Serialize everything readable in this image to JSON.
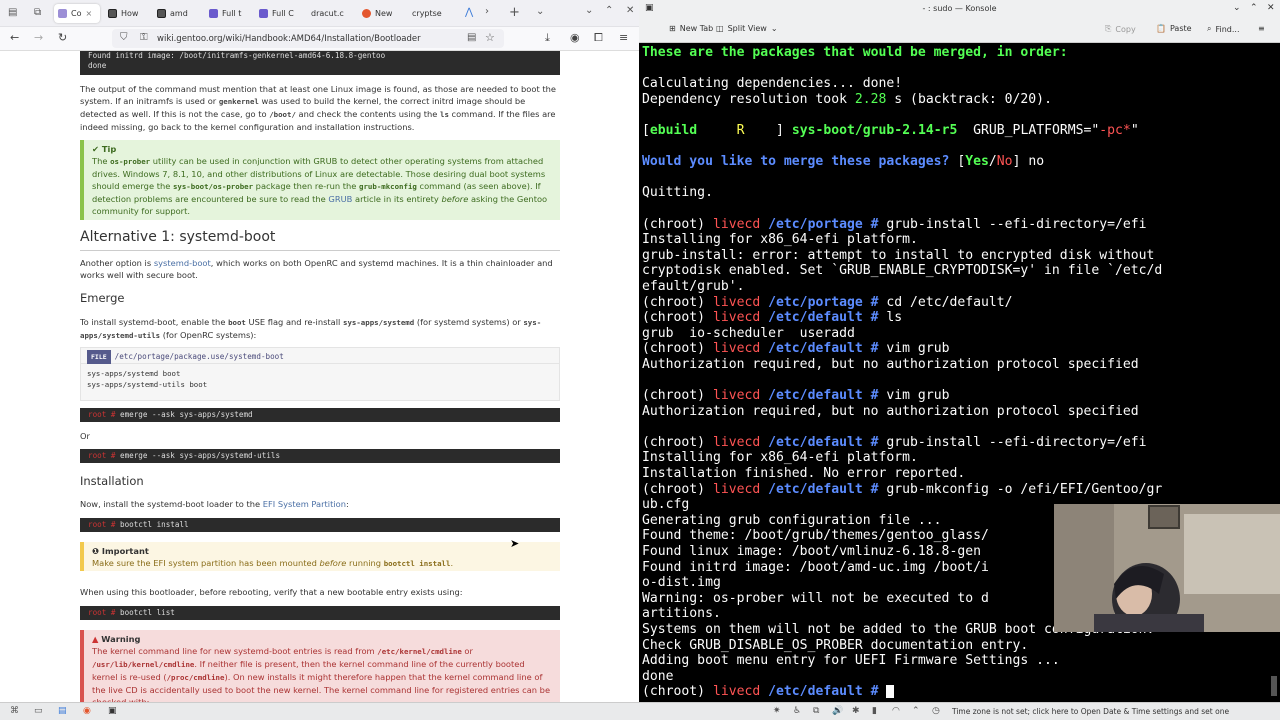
{
  "browser": {
    "tabs": [
      {
        "label": "Co",
        "active": true
      },
      {
        "label": "How"
      },
      {
        "label": "amd"
      },
      {
        "label": "Full t"
      },
      {
        "label": "Full C"
      },
      {
        "label": "dracut.c"
      },
      {
        "label": "New"
      },
      {
        "label": "cryptse"
      }
    ],
    "url": "wiki.gentoo.org/wiki/Handbook:AMD64/Installation/Bootloader",
    "content": {
      "code_top_line1": "Found initrd image: /boot/initramfs-genkernel-amd64-6.18.8-gentoo",
      "code_top_line2": "done",
      "para1": {
        "t1": "The output of the command must mention that at least one Linux image is found, as those are needed to boot the system. If an initramfs is used or ",
        "c1": "genkernel",
        "t2": " was used to build the kernel, the correct initrd image should be detected as well. If this is not the case, go to ",
        "c2": "/boot/",
        "t3": " and check the contents using the ",
        "c3": "ls",
        "t4": " command. If the files are indeed missing, go back to the kernel configuration and installation instructions."
      },
      "tip": {
        "title": "Tip",
        "t1": "The ",
        "c1": "os-prober",
        "t2": " utility can be used in conjunction with GRUB to detect other operating systems from attached drives. Windows 7, 8.1, 10, and other distributions of Linux are detectable. Those desiring dual boot systems should emerge the ",
        "c2": "sys-boot/os-prober",
        "t3": " package then re-run the ",
        "c3": "grub-mkconfig",
        "t4": " command (as seen above). If detection problems are encountered be sure to read the ",
        "link": "GRUB",
        "t5": " article in its entirety ",
        "em": "before",
        "t6": " asking the Gentoo community for support."
      },
      "alt_heading": "Alternative 1: systemd-boot",
      "alt_para": {
        "t1": "Another option is ",
        "link": "systemd-boot",
        "t2": ", which works on both OpenRC and systemd machines. It is a thin chainloader and works well with secure boot."
      },
      "emerge_heading": "Emerge",
      "emerge_para": {
        "t1": "To install systemd-boot, enable the ",
        "c1": "boot",
        "t2": " USE flag and re-install ",
        "c2": "sys-apps/systemd",
        "t3": " (for systemd systems) or ",
        "c3": "sys-apps/systemd-utils",
        "t4": " (for OpenRC systems):"
      },
      "file_badge": "FILE",
      "file_path": "/etc/portage/package.use/systemd-boot",
      "file_line1": "sys-apps/systemd boot",
      "file_line2": "sys-apps/systemd-utils boot",
      "root_prompt": "root #",
      "cmd1": "emerge --ask sys-apps/systemd",
      "or_text": "Or",
      "cmd2": "emerge --ask sys-apps/systemd-utils",
      "install_heading": "Installation",
      "install_para": {
        "t1": "Now, install the systemd-boot loader to the ",
        "link": "EFI System Partition",
        "t2": ":"
      },
      "cmd3": "bootctl install",
      "important": {
        "title": "Important",
        "t1": "Make sure the EFI system partition has been mounted ",
        "em": "before",
        "t2": " running ",
        "c1": "bootctl install",
        "t3": "."
      },
      "verify_para": "When using this bootloader, before rebooting, verify that a new bootable entry exists using:",
      "cmd4": "bootctl list",
      "warning": {
        "title": "Warning",
        "t1": "The kernel command line for new systemd-boot entries is read from ",
        "c1": "/etc/kernel/cmdline",
        "t2": " or ",
        "c2": "/usr/lib/kernel/cmdline",
        "t3": ". If neither file is present, then the kernel command line of the currently booted kernel is re-used (",
        "c3": "/proc/cmdline",
        "t4": "). On new installs it might therefore happen that the kernel command line of the live CD is accidentally used to boot the new kernel. The kernel command line for registered entries can be checked with:"
      }
    }
  },
  "konsole": {
    "title": "- : sudo — Konsole",
    "toolbar": {
      "new_tab": "New Tab",
      "split_view": "Split View",
      "copy": "Copy",
      "paste": "Paste",
      "find": "Find..."
    },
    "lines": {
      "l1": "These are the packages that would be merged, in order:",
      "l3": "Calculating dependencies... done!",
      "l4a": "Dependency resolution took ",
      "l4b": "2.28",
      "l4c": " s (backtrack: 0/20).",
      "l6a": "[",
      "l6b": "ebuild",
      "l6c": "     R    ",
      "l6d": "] ",
      "l6e": "sys-boot/grub-2.14-r5",
      "l6f": "  GRUB_PLATFORMS=\"",
      "l6g": "-pc*",
      "l6h": "\"",
      "l8a": "Would you like to merge these packages?",
      "l8b": " [",
      "l8c": "Yes",
      "l8d": "/",
      "l8e": "No",
      "l8f": "] no",
      "l10": "Quitting.",
      "p_chroot": "(chroot) ",
      "p_host": "livecd",
      "p_dir1": " /etc/portage #",
      "p_dir2": " /etc/default #",
      "c12": " grub-install --efi-directory=/efi",
      "o13": "Installing for x86_64-efi platform.",
      "o14": "grub-install: error: attempt to install to encrypted disk without",
      "o15": "cryptodisk enabled. Set `GRUB_ENABLE_CRYPTODISK=y' in file `/etc/d",
      "o16": "efault/grub'.",
      "c17": " cd /etc/default/",
      "c18": " ls",
      "o19": "grub  io-scheduler  useradd",
      "c20": " vim grub",
      "o21": "Authorization required, but no authorization protocol specified",
      "c23": " vim grub",
      "o24": "Authorization required, but no authorization protocol specified",
      "c26": " grub-install --efi-directory=/efi",
      "o27": "Installing for x86_64-efi platform.",
      "o28": "Installation finished. No error reported.",
      "c29": " grub-mkconfig -o /efi/EFI/Gentoo/gr",
      "o30": "ub.cfg",
      "o31": "Generating grub configuration file ...",
      "o32": "Found theme: /boot/grub/themes/gentoo_glass/",
      "o33": "Found linux image: /boot/vmlinuz-6.18.8-gen",
      "o34": "Found initrd image: /boot/amd-uc.img /boot/i",
      "o35": "o-dist.img",
      "o36": "Warning: os-prober will not be executed to d",
      "o37": "artitions.",
      "o38": "Systems on them will not be added to the GRUB boot configuration.",
      "o39": "Check GRUB_DISABLE_OS_PROBER documentation entry.",
      "o40": "Adding boot menu entry for UEFI Firmware Settings ...",
      "o41": "done"
    }
  },
  "taskbar": {
    "tooltip": "Time zone is not set; click here to Open Date & Time settings and set one"
  }
}
